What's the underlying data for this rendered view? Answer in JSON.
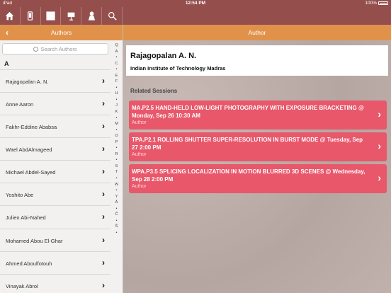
{
  "status": {
    "carrier": "iPad",
    "time": "12:54 PM",
    "battery": "100%"
  },
  "toolbar": {
    "icons": [
      "home-icon",
      "phone-icon",
      "grid-icon",
      "presentation-icon",
      "person-icon",
      "search-icon"
    ]
  },
  "left_nav": {
    "title": "Authors"
  },
  "right_nav": {
    "title": "Author"
  },
  "search": {
    "placeholder": "Search Authors"
  },
  "list": {
    "section": "A",
    "items": [
      {
        "name": "Rajagopalan A. N."
      },
      {
        "name": "Anne Aaron"
      },
      {
        "name": "Fakhr-Eddine Ababsa"
      },
      {
        "name": "Wael AbdAlmageed"
      },
      {
        "name": "Michael Abdel-Sayed"
      },
      {
        "name": "Yoshito Abe"
      },
      {
        "name": "Julien Abi-Nahed"
      },
      {
        "name": "Mohamed Abou El-Ghar"
      },
      {
        "name": "Ahmed Aboulfotouh"
      },
      {
        "name": "Vinayak Abrol"
      }
    ]
  },
  "index": [
    "Q",
    "A",
    "C",
    "E",
    "F",
    "H",
    "J",
    "K",
    "M",
    "O",
    "P",
    "R",
    "S",
    "T",
    "W",
    "Y",
    "Ä",
    "Č",
    "Š"
  ],
  "author": {
    "name": "Rajagopalan A. N.",
    "affiliation": "Indian Institute of Technology Madras"
  },
  "related_label": "Related Sessions",
  "sessions": [
    {
      "title": "MA.P2.5 HAND-HELD LOW-LIGHT PHOTOGRAPHY WITH EXPOSURE BRACKETING @ Monday, Sep 26 10:30 AM",
      "role": "Author"
    },
    {
      "title": "TPA.P2.1 ROLLING SHUTTER SUPER-RESOLUTION IN BURST MODE @ Tuesday, Sep 27 2:00 PM",
      "role": "Author"
    },
    {
      "title": "WPA.P3.5 SPLICING LOCALIZATION IN MOTION BLURRED 3D SCENES @ Wednesday, Sep 28 2:00 PM",
      "role": "Author"
    }
  ]
}
